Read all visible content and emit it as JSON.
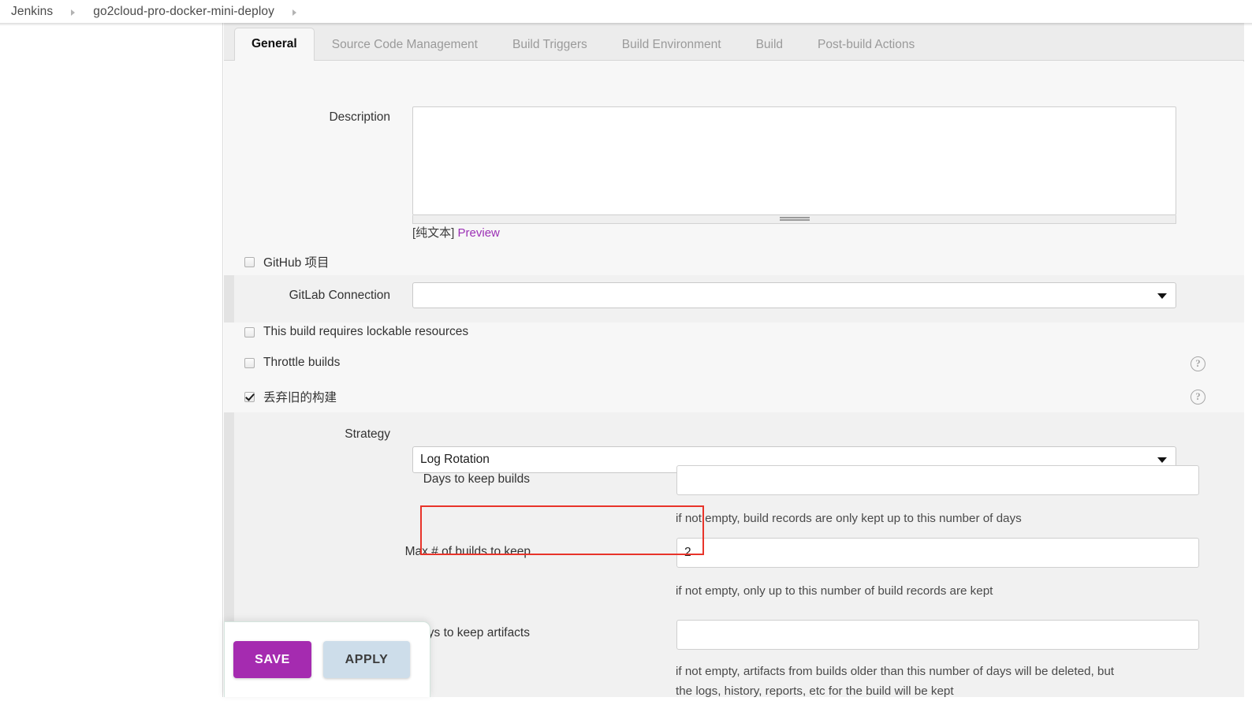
{
  "breadcrumb": {
    "items": [
      "Jenkins",
      "go2cloud-pro-docker-mini-deploy"
    ],
    "separator_icon": "chevron-right-icon"
  },
  "tabs": [
    {
      "label": "General",
      "active": true
    },
    {
      "label": "Source Code Management",
      "active": false
    },
    {
      "label": "Build Triggers",
      "active": false
    },
    {
      "label": "Build Environment",
      "active": false
    },
    {
      "label": "Build",
      "active": false
    },
    {
      "label": "Post-build Actions",
      "active": false
    }
  ],
  "form": {
    "description": {
      "label": "Description",
      "value": "",
      "markup_note": "[纯文本]",
      "preview_link": "Preview"
    },
    "github_project": {
      "label": "GitHub 项目",
      "checked": false
    },
    "gitlab_connection": {
      "label": "GitLab Connection",
      "value": "",
      "icon": "chevron-down-icon"
    },
    "lockable_resources": {
      "label": "This build requires lockable resources",
      "checked": false
    },
    "throttle_builds": {
      "label": "Throttle builds",
      "checked": false,
      "help_icon": "question-mark-icon"
    },
    "discard_old_builds": {
      "label": "丢弃旧的构建",
      "checked": true,
      "help_icon": "question-mark-icon"
    },
    "strategy": {
      "label": "Strategy",
      "value": "Log Rotation",
      "icon": "chevron-down-icon"
    },
    "days_to_keep_builds": {
      "label": "Days to keep builds",
      "value": "",
      "help": "if not empty, build records are only kept up to this number of days"
    },
    "max_builds_to_keep": {
      "label": "Max # of builds to keep",
      "value": "2",
      "help": "if not empty, only up to this number of build records are kept",
      "highlighted": true
    },
    "days_to_keep_artifacts": {
      "label": "Days to keep artifacts",
      "value": "",
      "help_line1": "if not empty, artifacts from builds older than this number of days will be deleted, but",
      "help_line2": "the logs, history, reports, etc for the build will be kept"
    }
  },
  "actions": {
    "save_label": "SAVE",
    "apply_label": "APPLY"
  },
  "colors": {
    "save_button": "#a52bb0",
    "apply_button": "#cdddea",
    "preview_link": "#9b30b5",
    "highlight_border": "#e8342a",
    "panel_background": "#f7f7f7",
    "tab_bar_background": "#ececec"
  },
  "help_symbol": "?"
}
